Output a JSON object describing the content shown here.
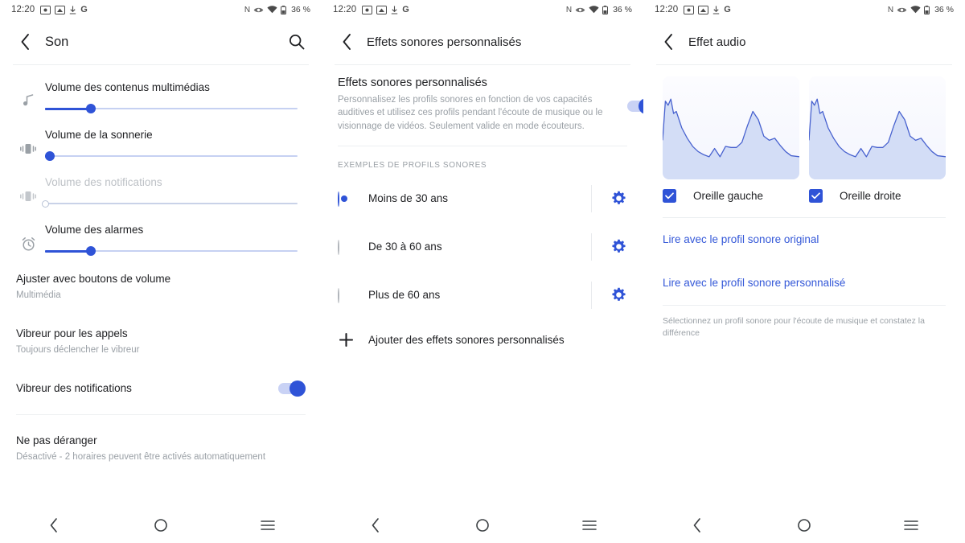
{
  "status_bar": {
    "time": "12:20",
    "left_icons": [
      "screenshot-icon",
      "cast-icon",
      "download-icon",
      "google-icon"
    ],
    "right_icons": [
      "nfc-icon",
      "eye-icon",
      "wifi-icon",
      "battery-icon"
    ],
    "nfc_label": "N",
    "battery_percent": "36 %"
  },
  "nav_bar": {
    "back_label": "back-icon",
    "home_label": "home-icon",
    "recents_label": "recents-icon"
  },
  "screen_sound": {
    "title": "Son",
    "search_icon": "search-icon",
    "volumes": [
      {
        "icon": "music-note-icon",
        "label": "Volume des contenus multimédias",
        "value_percent": 18,
        "disabled": false
      },
      {
        "icon": "ringer-icon",
        "label": "Volume de la sonnerie",
        "value_percent": 2,
        "disabled": false
      },
      {
        "icon": "notification-vibrate-icon",
        "label": "Volume des notifications",
        "value_percent": 0,
        "disabled": true
      },
      {
        "icon": "alarm-clock-icon",
        "label": "Volume des alarmes",
        "value_percent": 18,
        "disabled": false
      }
    ],
    "items": [
      {
        "title": "Ajuster avec boutons de volume",
        "subtitle": "Multimédia",
        "toggle": null
      },
      {
        "title": "Vibreur pour les appels",
        "subtitle": "Toujours déclencher le vibreur",
        "toggle": null
      },
      {
        "title": "Vibreur des notifications",
        "subtitle": "",
        "toggle": "on"
      }
    ],
    "items_after_divider": [
      {
        "title": "Ne pas déranger",
        "subtitle": "Désactivé - 2 horaires peuvent être activés automatiquement"
      }
    ],
    "clipped_item": "Multimédia"
  },
  "screen_effects": {
    "title": "Effets sonores personnalisés",
    "header": {
      "title": "Effets sonores personnalisés",
      "description": "Personnalisez les profils sonores en fonction de vos capacités auditives et utilisez ces profils pendant l'écoute de musique ou le visionnage de vidéos. Seulement valide en mode écouteurs.",
      "toggle": "on"
    },
    "section_label": "EXEMPLES DE PROFILS SONORES",
    "profiles": [
      {
        "label": "Moins de 30 ans",
        "selected": true,
        "gear_icon": "gear-icon"
      },
      {
        "label": "De 30 à 60 ans",
        "selected": false,
        "gear_icon": "gear-icon"
      },
      {
        "label": "Plus de 60 ans",
        "selected": false,
        "gear_icon": "gear-icon"
      }
    ],
    "add_label": "Ajouter des effets sonores personnalisés",
    "add_icon": "plus-icon"
  },
  "screen_audio_effect": {
    "title": "Effet audio",
    "ears": [
      {
        "label": "Oreille gauche",
        "checked": true
      },
      {
        "label": "Oreille droite",
        "checked": true
      }
    ],
    "links": [
      "Lire avec le profil sonore original",
      "Lire avec le profil sonore personnalisé"
    ],
    "note": "Sélectionnez un profil sonore pour l'écoute de musique et constatez la différence"
  },
  "colors": {
    "accent_blue": "#2f53d7",
    "link_blue": "#3458d8",
    "track_light": "#c6d1f2",
    "text_primary": "#202124",
    "text_secondary": "#9aa0a6",
    "chart_fill": "#ccd8f5",
    "chart_stroke": "#4862cf"
  },
  "chart_data": [
    {
      "type": "area",
      "title": "Oreille gauche",
      "xlabel": "",
      "ylabel": "",
      "grid": false,
      "legend": "none",
      "x": [
        0,
        2,
        4,
        6,
        8,
        10,
        12,
        14,
        18,
        22,
        26,
        30,
        34,
        38,
        42,
        46,
        50,
        54,
        58,
        62,
        66,
        70,
        74,
        78,
        82,
        86,
        90,
        94,
        100
      ],
      "values": [
        38,
        76,
        72,
        78,
        64,
        66,
        58,
        50,
        40,
        32,
        27,
        24,
        22,
        30,
        22,
        32,
        31,
        31,
        36,
        52,
        66,
        58,
        42,
        38,
        40,
        33,
        27,
        23,
        22
      ]
    },
    {
      "type": "area",
      "title": "Oreille droite",
      "xlabel": "",
      "ylabel": "",
      "grid": false,
      "legend": "none",
      "x": [
        0,
        2,
        4,
        6,
        8,
        10,
        12,
        14,
        18,
        22,
        26,
        30,
        34,
        38,
        42,
        46,
        50,
        54,
        58,
        62,
        66,
        70,
        74,
        78,
        82,
        86,
        90,
        94,
        100
      ],
      "values": [
        38,
        76,
        72,
        78,
        64,
        66,
        58,
        50,
        40,
        32,
        27,
        24,
        22,
        30,
        22,
        32,
        31,
        31,
        36,
        52,
        66,
        58,
        42,
        38,
        40,
        33,
        27,
        23,
        22
      ]
    }
  ]
}
